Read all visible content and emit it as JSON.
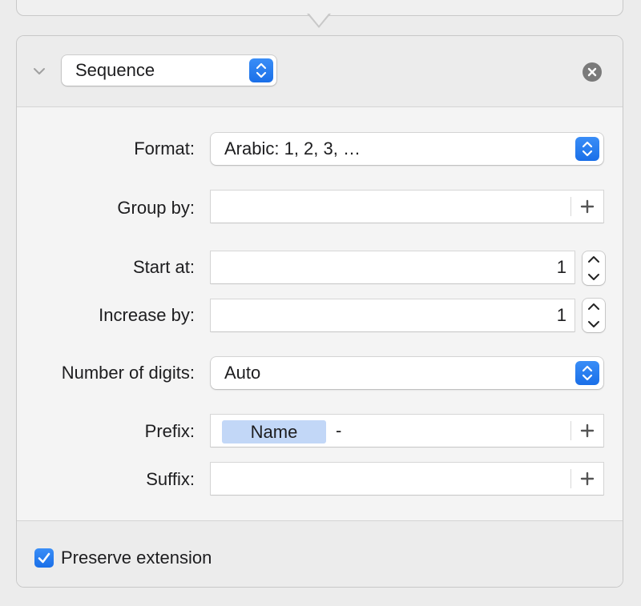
{
  "action": {
    "type_label": "Sequence",
    "collapsed_icon": "chevron-down-icon",
    "remove_icon": "close-icon"
  },
  "fields": {
    "format": {
      "label": "Format:",
      "value": "Arabic: 1, 2, 3, …"
    },
    "group_by": {
      "label": "Group by:",
      "value": ""
    },
    "start_at": {
      "label": "Start at:",
      "value": "1"
    },
    "increase_by": {
      "label": "Increase by:",
      "value": "1"
    },
    "number_of_digits": {
      "label": "Number of digits:",
      "value": "Auto"
    },
    "prefix": {
      "label": "Prefix:",
      "token": "Name",
      "text": "-"
    },
    "suffix": {
      "label": "Suffix:",
      "value": ""
    }
  },
  "footer": {
    "preserve_extension_label": "Preserve extension",
    "preserve_extension_checked": true
  },
  "colors": {
    "accent": "#1a6fe8",
    "token_bg": "#c2d7f7"
  }
}
